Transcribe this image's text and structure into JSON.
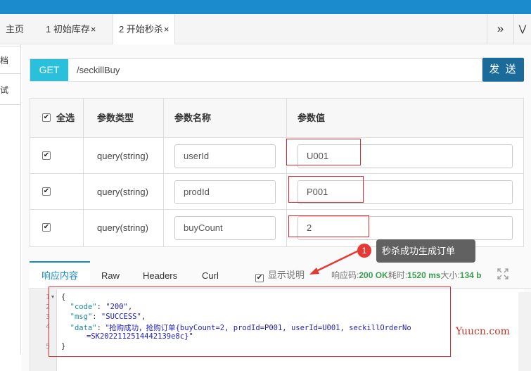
{
  "tabs": {
    "home": "主页",
    "tab1": "1 初始库存",
    "tab2": "2 开始秒杀",
    "close": "×",
    "more": "»",
    "expand": "⋁"
  },
  "left_panel": {
    "item1": "档",
    "item2": "试"
  },
  "request": {
    "method": "GET",
    "url": "/seckillBuy",
    "send_label": "发 送"
  },
  "params_table": {
    "headers": {
      "select_all": "全选",
      "type": "参数类型",
      "name": "参数名称",
      "value": "参数值"
    },
    "rows": [
      {
        "type": "query(string)",
        "name": "userId",
        "value": "U001",
        "checked": true
      },
      {
        "type": "query(string)",
        "name": "prodId",
        "value": "P001",
        "checked": true
      },
      {
        "type": "query(string)",
        "name": "buyCount",
        "value": "2",
        "checked": true
      }
    ]
  },
  "response": {
    "tabs": [
      "响应内容",
      "Raw",
      "Headers",
      "Curl"
    ],
    "show_desc": "显示说明",
    "status_label": "响应码:",
    "status_value": "200 OK",
    "time_label": "耗时:",
    "time_value": "1520 ms",
    "size_label": "大小:",
    "size_value": "134 b",
    "line_numbers": [
      "1",
      "2",
      "3",
      "4",
      "",
      "5"
    ],
    "code": {
      "open": "{",
      "code_key": "\"code\"",
      "code_val": "\"200\"",
      "msg_key": "\"msg\"",
      "msg_val": "\"SUCCESS\"",
      "data_key": "\"data\"",
      "data_val_cn": "\"抢购成功，抢购订单",
      "data_val_rest": "{buyCount=2, prodId=P001, userId=U001, seckillOrderNo",
      "data_val_line2": "=SK2022112514442139e8c}\"",
      "close": "}"
    }
  },
  "annotation": {
    "badge": "1",
    "text": "秒杀成功生成订单"
  },
  "watermark": "Yuucn.com",
  "colors": {
    "topbar": "#1b8bce",
    "method_bg": "#29c0db",
    "send_bg": "#1a6b9a",
    "highlight": "#e0282e",
    "status_ok": "#3a9e4e"
  }
}
